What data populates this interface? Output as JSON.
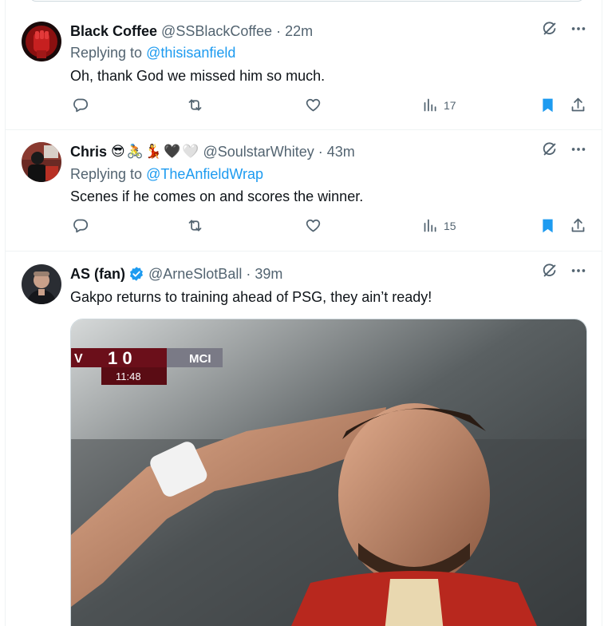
{
  "tweets": [
    {
      "name": "Black Coffee",
      "handle": "@SSBlackCoffee",
      "dot": "·",
      "time": "22m",
      "replying_prefix": "Replying to ",
      "replying_to": "@thisisanfield",
      "text": "Oh, thank God we missed him so much.",
      "views": "17"
    },
    {
      "name": "Chris",
      "emojis": [
        "😎",
        "🚴",
        "💃",
        "🖤",
        "🤍"
      ],
      "handle": "@SoulstarWhitey",
      "dot": "·",
      "time": "43m",
      "replying_prefix": "Replying to ",
      "replying_to": "@TheAnfieldWrap",
      "text": "Scenes if he comes on and scores the winner.",
      "views": "15"
    },
    {
      "name": "AS (fan)",
      "verified": true,
      "handle": "@ArneSlotBall",
      "dot": "·",
      "time": "39m",
      "text": "Gakpo returns to training ahead of PSG, they ain’t ready!",
      "media": {
        "scoreboard_left": "V",
        "score": "1 0",
        "clock": "11:48",
        "scoreboard_right": "MCI"
      }
    }
  ],
  "colors": {
    "accent": "#1d9bf0",
    "secondary_text": "#536471",
    "bookmark_active": "#1d9bf0"
  }
}
